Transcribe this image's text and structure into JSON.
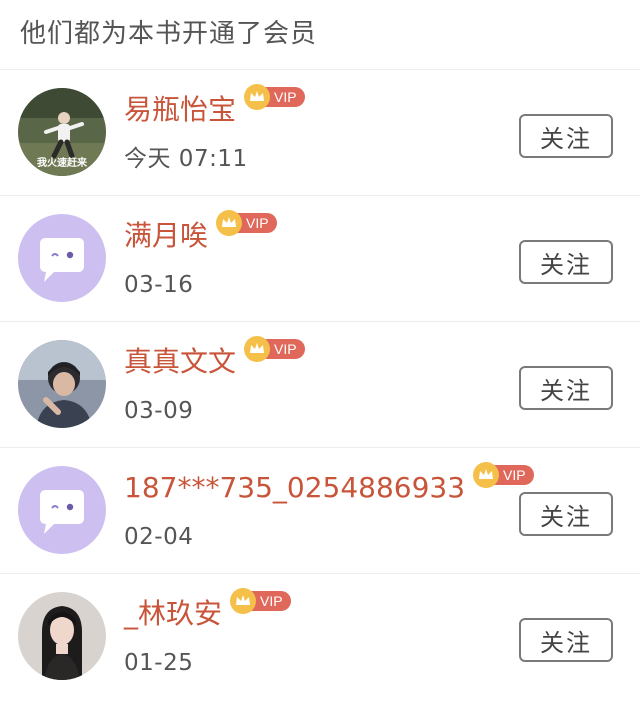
{
  "header": {
    "title": "他们都为本书开通了会员"
  },
  "vip": {
    "label": "VIP"
  },
  "members": [
    {
      "name": "易瓶怡宝",
      "date": "今天 07:11",
      "avatar": "photo-avatar",
      "avatar_caption": "我火速赶来"
    },
    {
      "name": "满月唉",
      "date": "03-16",
      "avatar": "default-avatar"
    },
    {
      "name": "真真文文",
      "date": "03-09",
      "avatar": "photo-avatar"
    },
    {
      "name": "187***735_0254886933",
      "date": "02-04",
      "avatar": "default-avatar"
    },
    {
      "name": "_林玖安",
      "date": "01-25",
      "avatar": "photo-avatar"
    }
  ],
  "follow_label": "关注",
  "colors": {
    "name": "#c8553a",
    "vip_badge": "#e0685a",
    "vip_crown": "#f5c04a",
    "default_avatar": "#cdbff0"
  }
}
